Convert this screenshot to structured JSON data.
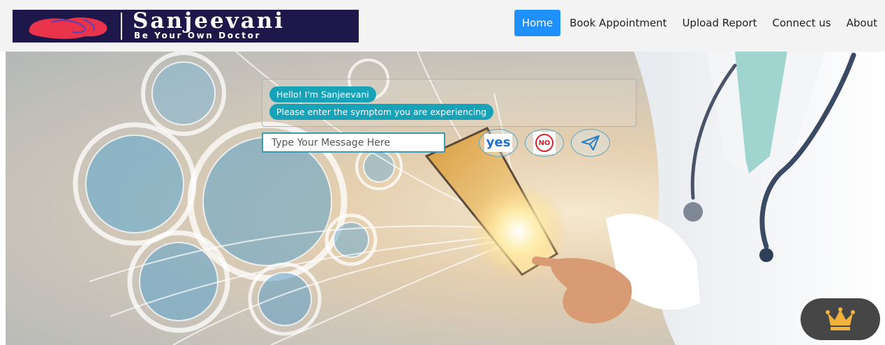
{
  "brand": {
    "title": "Sanjeevani",
    "tagline": "Be Your Own Doctor"
  },
  "nav": {
    "items": [
      {
        "label": "Home",
        "active": true
      },
      {
        "label": "Book Appointment",
        "active": false
      },
      {
        "label": "Upload Report",
        "active": false
      },
      {
        "label": "Connect us",
        "active": false
      },
      {
        "label": "About",
        "active": false
      }
    ]
  },
  "chat": {
    "messages": [
      "Hello! I'm Sanjeevani",
      "Please enter the symptom you are experiencing"
    ],
    "input_value": "",
    "input_placeholder": "Type Your Message Here",
    "yes_label": "yes",
    "no_label": "NO",
    "send_icon": "paper-plane-icon"
  },
  "floating_button": {
    "icon": "crown-icon"
  },
  "colors": {
    "nav_active": "#1e90ff",
    "bubble": "#17a2b8",
    "logo_bg": "#1e1749",
    "crown": "#f2b33d"
  }
}
